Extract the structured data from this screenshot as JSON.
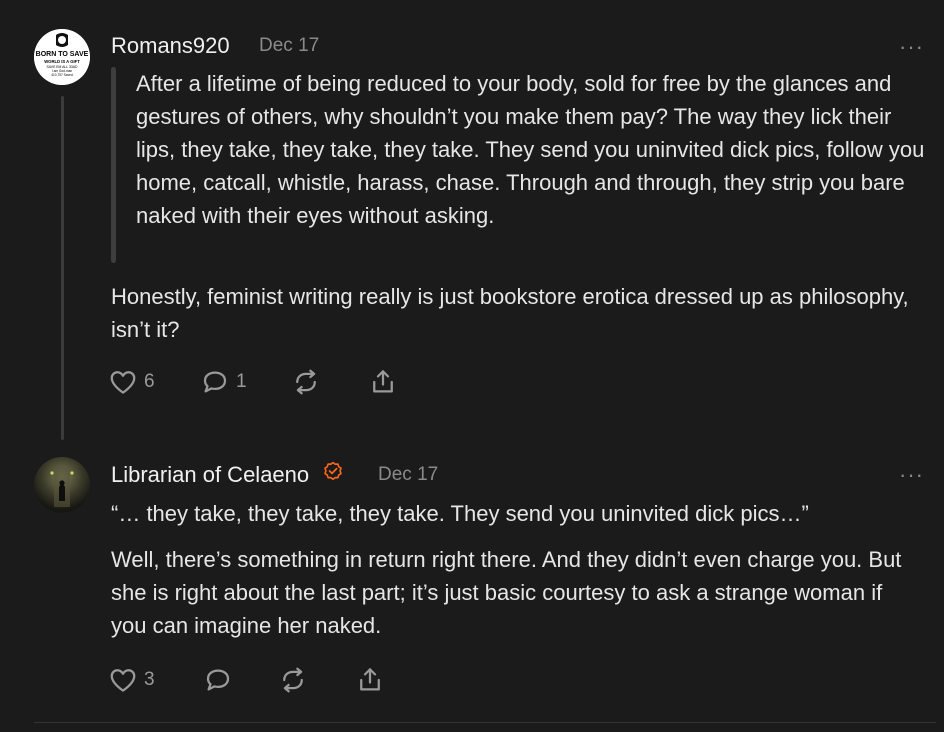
{
  "comments": [
    {
      "author": "Romans920",
      "date": "Dec 17",
      "avatar_text": [
        "BORN TO SAVE",
        "WORLD IS A GIFT",
        "SAVE EM ALL 33AD",
        "I am God-man",
        "410,757 Saved"
      ],
      "quote": "After a lifetime of being reduced to your body, sold for free by the glances and gestures of others, why shouldn’t you make them pay? The way they lick their lips, they take, they take, they take. They send you uninvited dick pics, follow you home, catcall, whistle, harass, chase. Through and through, they strip you bare naked with their eyes without asking.",
      "body": "Honestly, feminist writing really is just bookstore erotica dressed up as philosophy, isn’t it?",
      "likes": "6",
      "replies": "1",
      "more": "···"
    },
    {
      "author": "Librarian of Celaeno",
      "date": "Dec 17",
      "verified": true,
      "quote_line": "“… they take, they take, they take. They send you uninvited dick pics…”",
      "body": "Well, there’s something in return right there. And they didn’t even charge you. But she is right about the last part; it’s just basic courtesy to ask a strange woman if you can imagine her naked.",
      "likes": "3",
      "more": "···"
    }
  ],
  "icons": {
    "like": "heart-icon",
    "reply": "comment-bubble-icon",
    "restack": "restack-icon",
    "share": "share-icon",
    "verified": "verified-badge-icon"
  },
  "colors": {
    "background": "#1b1b1b",
    "accent": "#ff6719",
    "muted": "#8a8a8a"
  }
}
